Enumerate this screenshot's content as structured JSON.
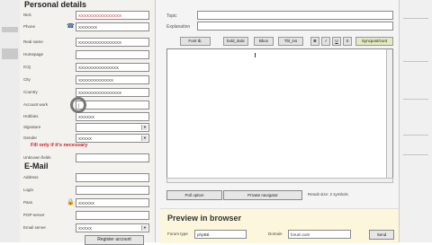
{
  "left": {
    "title": "Personal details",
    "email_title": "E-Mail",
    "note": "Fill only if it's necessary",
    "register_button": "Register account",
    "rows": [
      {
        "label": "Nick",
        "value": "XXXXXXXXXXXXXXXX",
        "red": true
      },
      {
        "label": "Phone",
        "value": "XXXXXXX",
        "icon": "☎"
      },
      {
        "label": "Real name",
        "value": "XXXXXXXXXXXXXXXX"
      },
      {
        "label": "Homepage",
        "value": ""
      },
      {
        "label": "ICQ",
        "value": "XXXXXXXXXXXXXXX"
      },
      {
        "label": "City",
        "value": "XXXXXXXXXXXXX"
      },
      {
        "label": "Country",
        "value": "XXXXXXXXXXXXXXXX"
      },
      {
        "label": "Account work",
        "value": "|"
      },
      {
        "label": "Hobbies",
        "value": "XXXXXX"
      },
      {
        "label": "Signature",
        "value": "",
        "dropdown": true
      },
      {
        "label": "Gender",
        "value": "XXXXX",
        "dropdown": true
      },
      {
        "label": "Unknown fields",
        "value": ""
      },
      {
        "label": "Address",
        "value": ""
      },
      {
        "label": "Login",
        "value": ""
      },
      {
        "label": "Pass",
        "value": "XXXXXX",
        "icon": "🔒"
      },
      {
        "label": "POP-server",
        "value": ""
      },
      {
        "label": "Email server",
        "value": "XXXXX",
        "dropdown": true
      }
    ]
  },
  "right": {
    "topic_label": "Topic",
    "explanation_label": "Explanation",
    "toolbar": [
      "Font tb.",
      "bold_italic",
      "Bbox",
      "Tbl_ins"
    ],
    "format_buttons": [
      "B",
      "I",
      "U",
      "S"
    ],
    "special_button": "Syncpost/cont",
    "buttons": [
      "Poll option",
      "Private navigator"
    ],
    "result_text": "Result size: 2 symbols",
    "preview_title": "Preview in browser",
    "preview": {
      "forum_type_label": "Forum type",
      "forum_type_value": "phpBB",
      "domain_label": "Domain",
      "domain_value": "forum.com",
      "send_button": "Send"
    }
  },
  "colors": {
    "note": "#cc2222",
    "preview_bg": "#fbf6dc"
  }
}
